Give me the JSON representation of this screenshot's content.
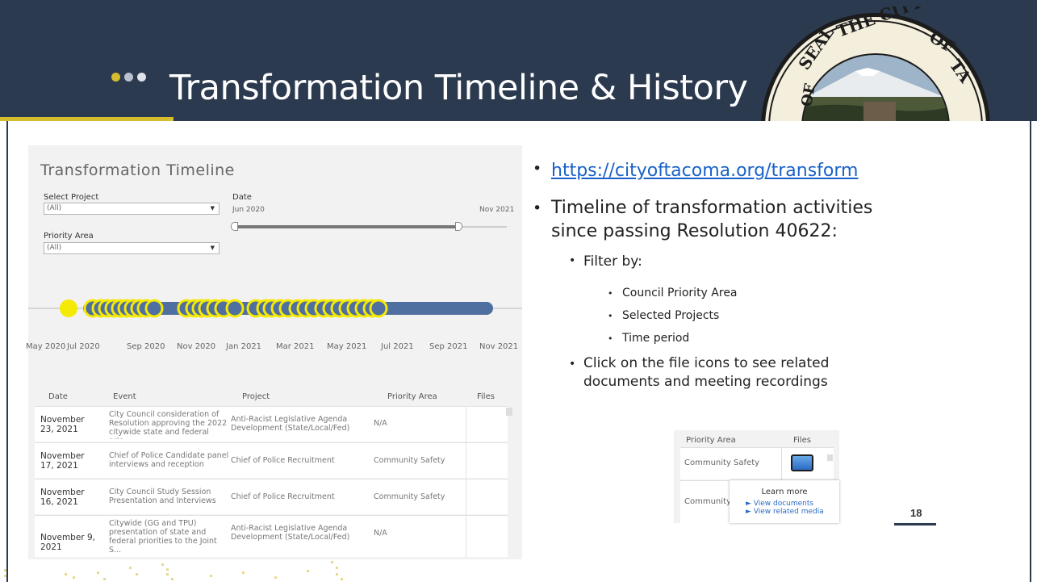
{
  "slide": {
    "title": "Transformation Timeline & History",
    "page_number": "18",
    "colors": {
      "header": "#2b3a4f",
      "accent": "#d6bd2f",
      "dot1": "#d6bd2f",
      "dot2": "#b8c1cf",
      "dot3": "#dfe3ea"
    }
  },
  "seal": {
    "text": "SEAL OF THE CITY OF TACOMA"
  },
  "dashboard": {
    "title": "Transformation Timeline",
    "filters": {
      "project_label": "Select Project",
      "project_value": "(All)",
      "priority_label": "Priority Area",
      "priority_value": "(All)",
      "date_label": "Date",
      "date_start": "Jun 2020",
      "date_end": "Nov 2021"
    },
    "axis_ticks": [
      "May 2020",
      "Jul 2020",
      "Sep 2020",
      "Nov 2020",
      "Jan 2021",
      "Mar 2021",
      "May 2021",
      "Jul 2021",
      "Sep 2021",
      "Nov 2021"
    ],
    "columns": [
      "Date",
      "Event",
      "Project",
      "Priority Area",
      "Files"
    ],
    "rows": [
      {
        "date": "November 23, 2021",
        "event": "City Council consideration of Resolution approving the 2022 citywide state and federal prio...",
        "project": "Anti-Racist Legislative Agenda Development (State/Local/Fed)",
        "area": "N/A"
      },
      {
        "date": "November 17, 2021",
        "event": "Chief of Police Candidate panel interviews and reception",
        "project": "Chief of Police Recruitment",
        "area": "Community Safety"
      },
      {
        "date": "November 16, 2021",
        "event": "City Council Study Session Presentation and Interviews",
        "project": "Chief of Police Recruitment",
        "area": "Community Safety"
      },
      {
        "date": "November 9, 2021",
        "event": "Citywide (GG and TPU) presentation of state and federal priorities to the Joint S...",
        "project": "Anti-Racist Legislative Agenda Development (State/Local/Fed)",
        "area": "N/A"
      }
    ],
    "marker_colors": {
      "highlight": "#f5e906",
      "default": "#4f6fa0"
    }
  },
  "bullets": {
    "link": "https://cityoftacoma.org/transform",
    "timeline_line1": "Timeline of transformation activities",
    "timeline_line2": "since passing Resolution 40622:",
    "filter_by": "Filter by:",
    "filter_items": [
      "Council Priority Area",
      "Selected Projects",
      "Time period"
    ],
    "click_line1": "Click on the file icons to see related",
    "click_line2": "documents and meeting recordings"
  },
  "mini": {
    "col_area": "Priority Area",
    "col_files": "Files",
    "row1_area": "Community Safety",
    "row2_area": "Community",
    "popup_title": "Learn more",
    "popup_link1": "► View documents",
    "popup_link2": "► View related media"
  }
}
